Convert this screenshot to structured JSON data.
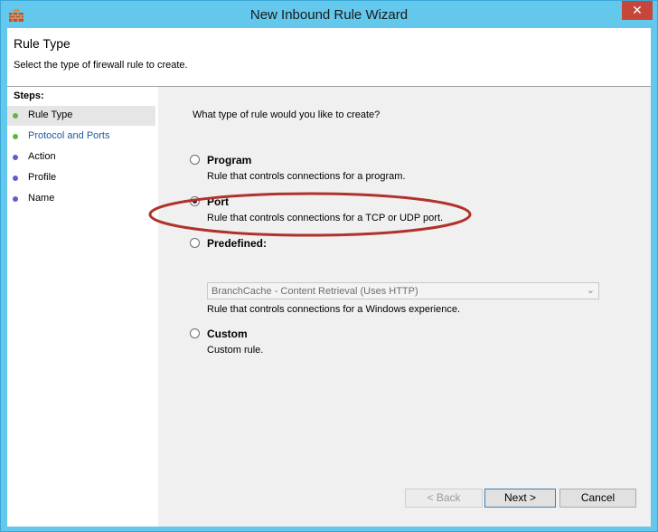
{
  "window": {
    "title": "New Inbound Rule Wizard",
    "close_glyph": "✕"
  },
  "header": {
    "title": "Rule Type",
    "description": "Select the type of firewall rule to create."
  },
  "steps": {
    "title": "Steps:",
    "items": [
      {
        "label": "Rule Type",
        "color": "#5fb83b"
      },
      {
        "label": "Protocol and Ports",
        "color": "#5fb83b"
      },
      {
        "label": "Action",
        "color": "#5a62c8"
      },
      {
        "label": "Profile",
        "color": "#5a62c8"
      },
      {
        "label": "Name",
        "color": "#5a62c8"
      }
    ]
  },
  "main": {
    "question": "What type of rule would you like to create?",
    "options": [
      {
        "label": "Program",
        "description": "Rule that controls connections for a program.",
        "selected": false
      },
      {
        "label": "Port",
        "description": "Rule that controls connections for a TCP or UDP port.",
        "selected": true
      },
      {
        "label": "Predefined:",
        "description": "Rule that controls connections for a Windows experience.",
        "selected": false
      },
      {
        "label": "Custom",
        "description": "Custom rule.",
        "selected": false
      }
    ],
    "predefined_select": {
      "value": "BranchCache - Content Retrieval (Uses HTTP)"
    }
  },
  "buttons": {
    "back": "< Back",
    "next": "Next >",
    "cancel": "Cancel"
  },
  "colors": {
    "titlebar": "#64c8ec",
    "close": "#c7463a",
    "annotation": "#b0322a"
  }
}
